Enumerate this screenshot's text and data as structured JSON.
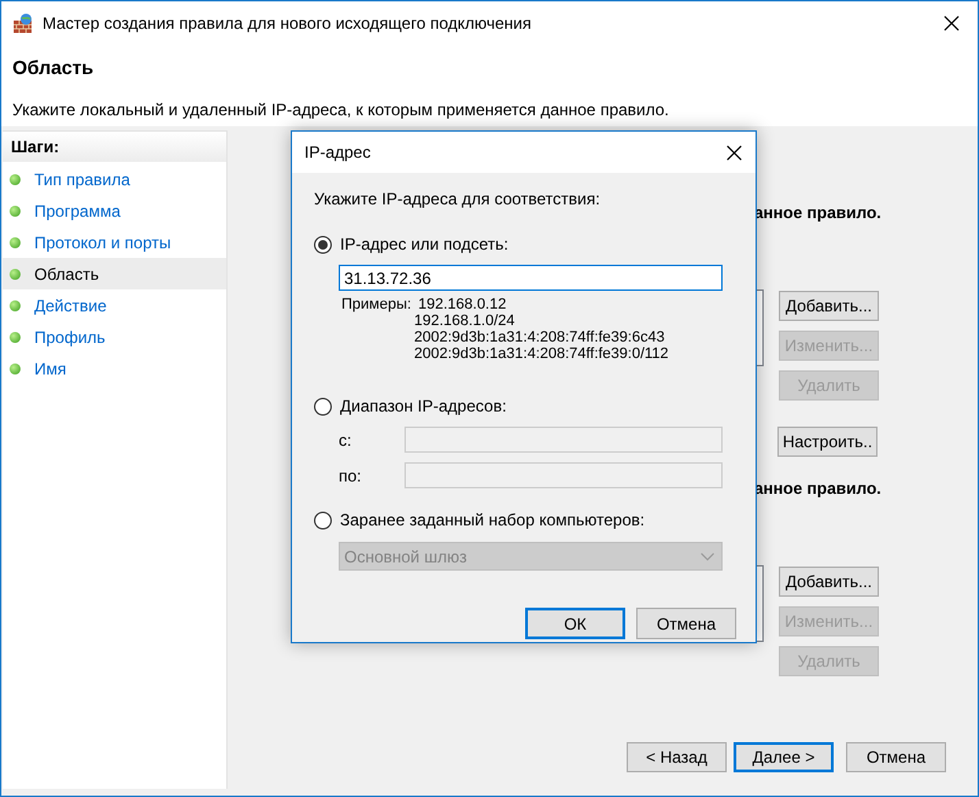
{
  "window": {
    "title": "Мастер создания правила для нового исходящего подключения"
  },
  "header": {
    "title": "Область",
    "subtitle": "Укажите локальный и удаленный IP-адреса, к которым применяется данное правило."
  },
  "steps": {
    "heading": "Шаги:",
    "items": [
      {
        "label": "Тип правила",
        "selected": false
      },
      {
        "label": "Программа",
        "selected": false
      },
      {
        "label": "Протокол и порты",
        "selected": false
      },
      {
        "label": "Область",
        "selected": true
      },
      {
        "label": "Действие",
        "selected": false
      },
      {
        "label": "Профиль",
        "selected": false
      },
      {
        "label": "Имя",
        "selected": false
      }
    ]
  },
  "local_section": {
    "caption": "анное правило.",
    "buttons": [
      {
        "label": "Добавить...",
        "disabled": false
      },
      {
        "label": "Изменить...",
        "disabled": true
      },
      {
        "label": "Удалить",
        "disabled": true
      }
    ],
    "customize_button": "Настроить.."
  },
  "remote_section": {
    "caption": "анное правило.",
    "buttons": [
      {
        "label": "Добавить...",
        "disabled": false
      },
      {
        "label": "Изменить...",
        "disabled": true
      },
      {
        "label": "Удалить",
        "disabled": true
      }
    ]
  },
  "nav_buttons": [
    {
      "label": "< Назад",
      "focused": false
    },
    {
      "label": "Далее >",
      "focused": true
    },
    {
      "label": "Отмена",
      "focused": false
    }
  ],
  "dialog": {
    "title": "IP-адрес",
    "prompt": "Укажите IP-адреса для соответствия:",
    "options": [
      {
        "kind": "address",
        "label": "IP-адрес или подсеть:",
        "selected": true,
        "value": "31.13.72.36",
        "examples_label": "Примеры:",
        "examples": [
          "192.168.0.12",
          "192.168.1.0/24",
          "2002:9d3b:1a31:4:208:74ff:fe39:6c43",
          "2002:9d3b:1a31:4:208:74ff:fe39:0/112"
        ]
      },
      {
        "kind": "range",
        "label": "Диапазон IP-адресов:",
        "selected": false,
        "from_label": "с:",
        "to_label": "по:"
      },
      {
        "kind": "preset",
        "label": "Заранее заданный набор компьютеров:",
        "selected": false,
        "value": "Основной шлюз"
      }
    ],
    "buttons": [
      {
        "label": "ОК",
        "focused": true
      },
      {
        "label": "Отмена",
        "focused": false
      }
    ]
  }
}
